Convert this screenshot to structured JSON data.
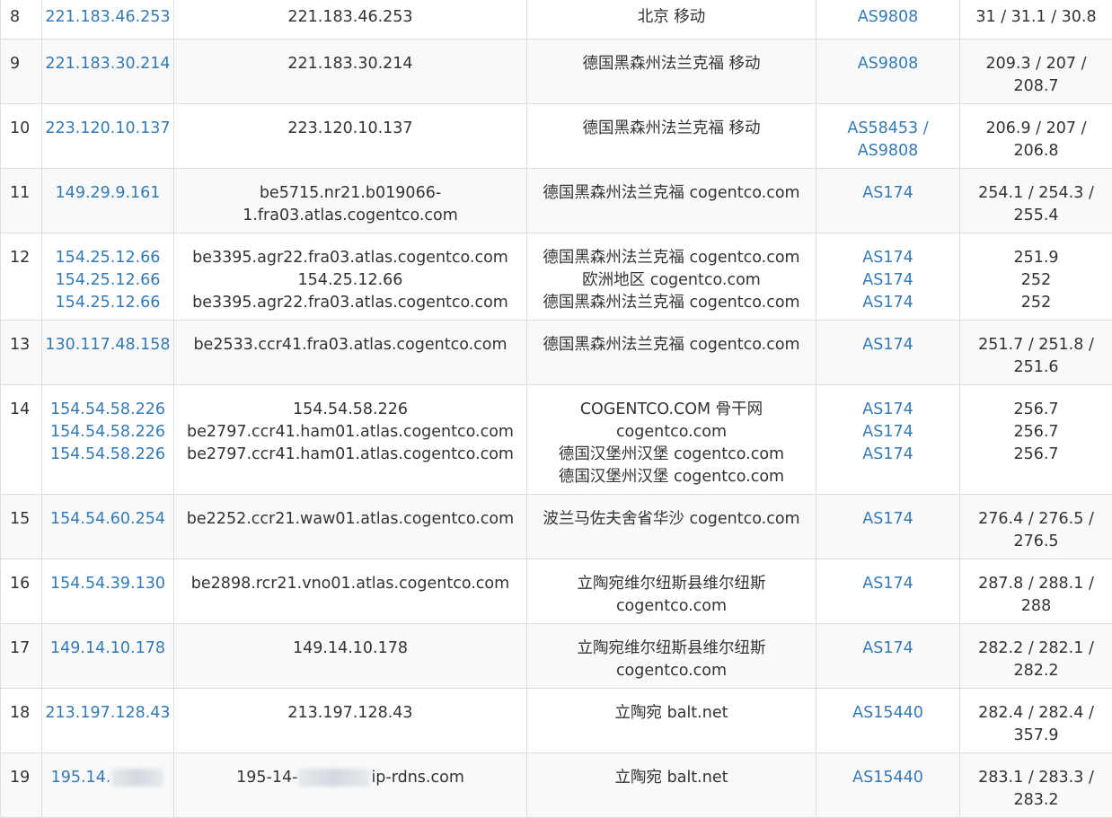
{
  "rows": [
    {
      "hop": "8",
      "ips": [
        "221.183.46.253"
      ],
      "hosts": [
        "221.183.46.253"
      ],
      "locs": [
        "北京 移动"
      ],
      "asns": [
        "AS9808"
      ],
      "lat": [
        "31 / 31.1 / 30.8"
      ]
    },
    {
      "hop": "9",
      "ips": [
        "221.183.30.214"
      ],
      "hosts": [
        "221.183.30.214"
      ],
      "locs": [
        "德国黑森州法兰克福 移动"
      ],
      "asns": [
        "AS9808"
      ],
      "lat": [
        "209.3 / 207 /",
        "208.7"
      ]
    },
    {
      "hop": "10",
      "ips": [
        "223.120.10.137"
      ],
      "hosts": [
        "223.120.10.137"
      ],
      "locs": [
        "德国黑森州法兰克福 移动"
      ],
      "asns": [
        "AS58453 /",
        "AS9808"
      ],
      "lat": [
        "206.9 / 207 /",
        "206.8"
      ]
    },
    {
      "hop": "11",
      "ips": [
        "149.29.9.161"
      ],
      "hosts": [
        "be5715.nr21.b019066-",
        "1.fra03.atlas.cogentco.com"
      ],
      "locs": [
        "德国黑森州法兰克福 cogentco.com"
      ],
      "asns": [
        "AS174"
      ],
      "lat": [
        "254.1 / 254.3 /",
        "255.4"
      ]
    },
    {
      "hop": "12",
      "ips": [
        "154.25.12.66",
        "154.25.12.66",
        "154.25.12.66"
      ],
      "hosts": [
        "be3395.agr22.fra03.atlas.cogentco.com",
        "154.25.12.66",
        "be3395.agr22.fra03.atlas.cogentco.com"
      ],
      "locs": [
        "德国黑森州法兰克福 cogentco.com",
        "欧洲地区 cogentco.com",
        "德国黑森州法兰克福 cogentco.com"
      ],
      "asns": [
        "AS174",
        "AS174",
        "AS174"
      ],
      "lat": [
        "251.9",
        "252",
        "252"
      ]
    },
    {
      "hop": "13",
      "ips": [
        "130.117.48.158"
      ],
      "hosts": [
        "be2533.ccr41.fra03.atlas.cogentco.com"
      ],
      "locs": [
        "德国黑森州法兰克福 cogentco.com"
      ],
      "asns": [
        "AS174"
      ],
      "lat": [
        "251.7 / 251.8 /",
        "251.6"
      ]
    },
    {
      "hop": "14",
      "ips": [
        "154.54.58.226",
        "154.54.58.226",
        "154.54.58.226"
      ],
      "hosts": [
        "154.54.58.226",
        "be2797.ccr41.ham01.atlas.cogentco.com",
        "be2797.ccr41.ham01.atlas.cogentco.com"
      ],
      "locs": [
        "COGENTCO.COM 骨干网",
        "cogentco.com",
        "德国汉堡州汉堡 cogentco.com",
        "德国汉堡州汉堡 cogentco.com"
      ],
      "asns": [
        "AS174",
        "AS174",
        "AS174"
      ],
      "lat": [
        "256.7",
        "256.7",
        "256.7"
      ]
    },
    {
      "hop": "15",
      "ips": [
        "154.54.60.254"
      ],
      "hosts": [
        "be2252.ccr21.waw01.atlas.cogentco.com"
      ],
      "locs": [
        "波兰马佐夫舍省华沙 cogentco.com"
      ],
      "asns": [
        "AS174"
      ],
      "lat": [
        "276.4 / 276.5 /",
        "276.5"
      ]
    },
    {
      "hop": "16",
      "ips": [
        "154.54.39.130"
      ],
      "hosts": [
        "be2898.rcr21.vno01.atlas.cogentco.com"
      ],
      "locs": [
        "立陶宛维尔纽斯县维尔纽斯",
        "cogentco.com"
      ],
      "asns": [
        "AS174"
      ],
      "lat": [
        "287.8 / 288.1 /",
        "288"
      ]
    },
    {
      "hop": "17",
      "ips": [
        "149.14.10.178"
      ],
      "hosts": [
        "149.14.10.178"
      ],
      "locs": [
        "立陶宛维尔纽斯县维尔纽斯",
        "cogentco.com"
      ],
      "asns": [
        "AS174"
      ],
      "lat": [
        "282.2 / 282.1 /",
        "282.2"
      ]
    },
    {
      "hop": "18",
      "ips": [
        "213.197.128.43"
      ],
      "hosts": [
        "213.197.128.43"
      ],
      "locs": [
        "立陶宛 balt.net"
      ],
      "asns": [
        "AS15440"
      ],
      "lat": [
        "282.4 / 282.4 /",
        "357.9"
      ]
    },
    {
      "hop": "19",
      "ips": [
        "195.14."
      ],
      "hosts": [
        "195-14-"
      ],
      "host_suffix": "ip-rdns.com",
      "locs": [
        "立陶宛 balt.net"
      ],
      "asns": [
        "AS15440"
      ],
      "lat": [
        "283.1 / 283.3 /",
        "283.2"
      ]
    }
  ],
  "colors": {
    "link": "#337ab7",
    "text": "#333333",
    "border": "#dddddd",
    "stripe": "#f9f9f9"
  }
}
